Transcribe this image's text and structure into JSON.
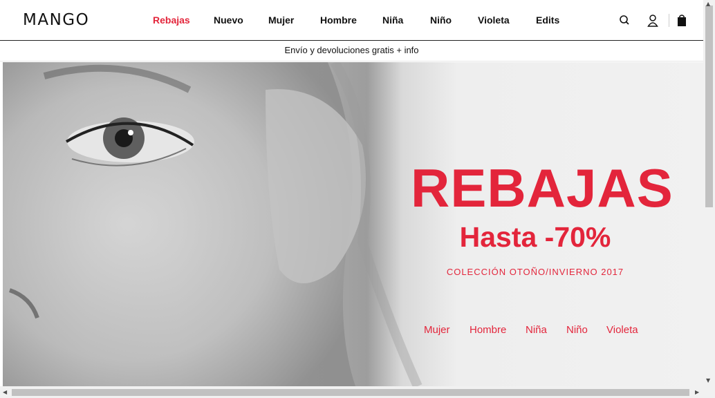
{
  "colors": {
    "accent": "#e3253b",
    "text": "#111111"
  },
  "header": {
    "logo": "MANGO",
    "nav": [
      "Rebajas",
      "Nuevo",
      "Mujer",
      "Hombre",
      "Niña",
      "Niño",
      "Violeta",
      "Edits"
    ],
    "active": "Rebajas",
    "icons": [
      "search-icon",
      "user-icon",
      "shopping-bag-icon"
    ]
  },
  "promo": {
    "text": "Envío y devoluciones gratis",
    "link": "+ info"
  },
  "hero": {
    "title": "REBAJAS",
    "subtitle": "Hasta -70%",
    "collection": "COLECCIÓN OTOÑO/INVIERNO 2017",
    "links": [
      "Mujer",
      "Hombre",
      "Niña",
      "Niño",
      "Violeta"
    ]
  }
}
